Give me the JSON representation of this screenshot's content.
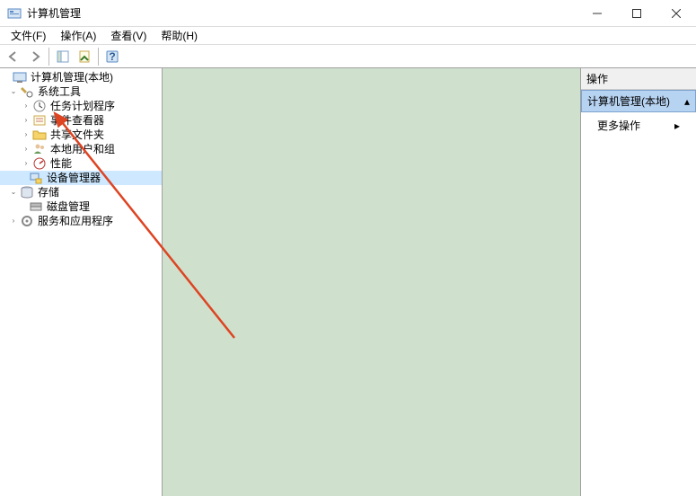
{
  "titlebar": {
    "title": "计算机管理"
  },
  "menubar": {
    "items": [
      {
        "label": "文件(F)"
      },
      {
        "label": "操作(A)"
      },
      {
        "label": "查看(V)"
      },
      {
        "label": "帮助(H)"
      }
    ]
  },
  "tree": {
    "root": "计算机管理(本地)",
    "sys_tools": "系统工具",
    "task_sched": "任务计划程序",
    "event_viewer": "事件查看器",
    "shared": "共享文件夹",
    "users": "本地用户和组",
    "perf": "性能",
    "devmgr": "设备管理器",
    "storage": "存储",
    "disk": "磁盘管理",
    "services": "服务和应用程序"
  },
  "actions": {
    "header": "操作",
    "context": "计算机管理(本地)",
    "more": "更多操作"
  }
}
